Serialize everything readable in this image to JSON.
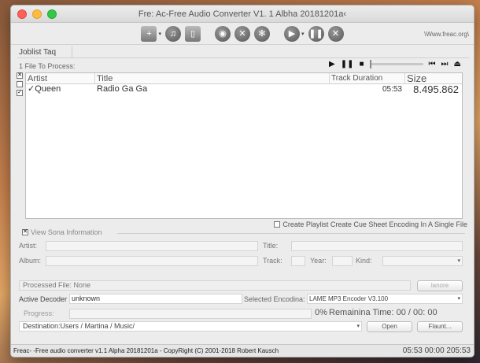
{
  "window": {
    "title": "Fre: Ac-Free Audio Converter V1. 1 Albha 20181201a‹"
  },
  "toolbar": {
    "url": "\\Www.freac.org\\"
  },
  "tabs": {
    "joblist": "Joblist Taq"
  },
  "joblist": {
    "count": "1 File To Process:",
    "columns": {
      "artist": "Artist",
      "title": "Title",
      "duration": "Track Duration",
      "size": "Size"
    },
    "rows": [
      {
        "artist": "Queen",
        "title": "Radio Ga Ga",
        "duration": "05:53",
        "size": "8.495.862"
      }
    ]
  },
  "options": {
    "playlist": "Create Playlist Create Cue Sheet Encoding In A Single File"
  },
  "song_info": {
    "legend": "View Sona Information",
    "artist": "Artist:",
    "title": "Title:",
    "album": "Album:",
    "track": "Track:",
    "year": "Year:",
    "kind": "Kind:"
  },
  "encoder": {
    "processed_file": "Processed File: None",
    "ignore": "lanore",
    "active_decoder_label": "Active Decoder",
    "active_decoder_value": "unknown",
    "selected_encoding_label": "Selected Encodina:",
    "selected_encoding_value": "LAME MP3 Encoder V3.100",
    "progress_label": "Progress:",
    "progress_percent": "0%",
    "remaining": "Remainina Time: 00 / 00: 00",
    "destination": "Destination:Users / Martina / Music/",
    "open": "Open",
    "browse": "Flaunt..."
  },
  "status": {
    "left": "Freac- -Free audio converter v1.1 Alpha 20181201a - CopyRight (C) 2001-2018 Robert Kausch",
    "right": "05:53 00:00 205:53"
  }
}
